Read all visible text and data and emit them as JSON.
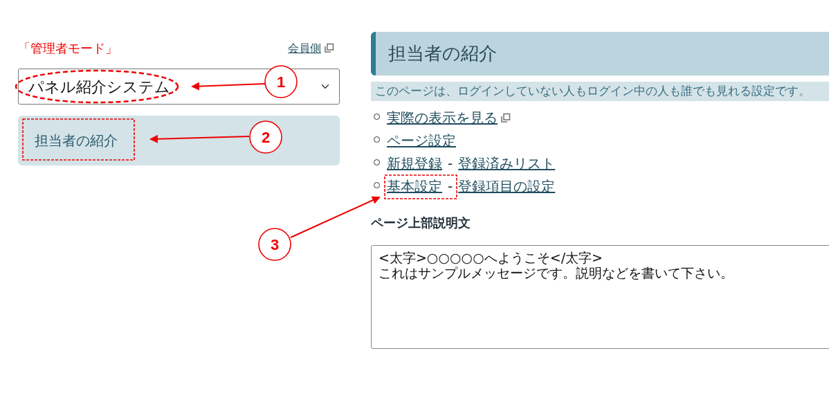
{
  "admin_mode_label": "「管理者モード」",
  "member_side_link": {
    "label": "会員側",
    "external": true
  },
  "system_select": {
    "value": "パネル紹介システム"
  },
  "sidebar": {
    "items": [
      {
        "label": "担当者の紹介",
        "selected": true
      }
    ]
  },
  "page": {
    "title": "担当者の紹介",
    "notice": "このページは、ログインしていない人もログイン中の人も誰でも見れる設定です。",
    "link_rows": [
      {
        "links": [
          {
            "label": "実際の表示を見る",
            "external": true
          }
        ]
      },
      {
        "links": [
          {
            "label": "ページ設定",
            "external": false
          }
        ]
      },
      {
        "links": [
          {
            "label": "新規登録",
            "external": false
          },
          {
            "label": "登録済みリスト",
            "external": false
          }
        ],
        "separator": "-"
      },
      {
        "links": [
          {
            "label": "基本設定",
            "external": false
          },
          {
            "label": "登録項目の設定",
            "external": false
          }
        ],
        "separator": "-"
      }
    ]
  },
  "description": {
    "label": "ページ上部説明文",
    "value": "<太字>○○○○○へようこそ</太字>\nこれはサンプルメッセージです。説明などを書いて下さい。"
  },
  "annotations": [
    {
      "number": "1",
      "kind": "ellipse"
    },
    {
      "number": "2",
      "kind": "frame"
    },
    {
      "number": "3",
      "kind": "frame"
    }
  ]
}
